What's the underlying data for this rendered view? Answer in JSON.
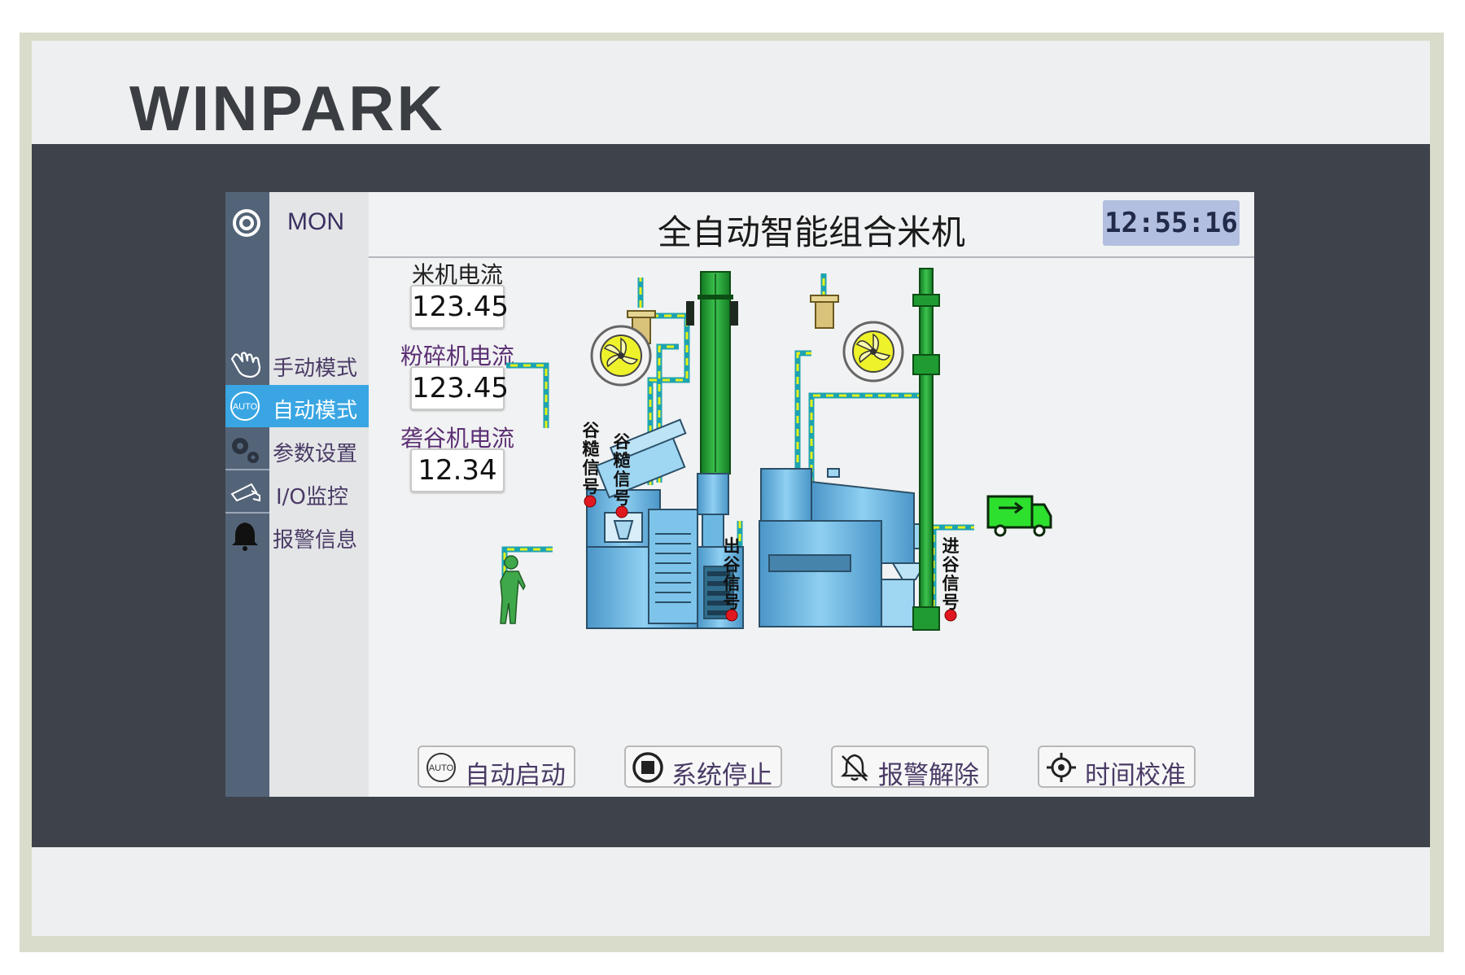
{
  "brand": "WINPARK",
  "screen": {
    "mon_label": "MON",
    "title": "全自动智能组合米机",
    "clock": "12:55:16"
  },
  "menu": {
    "items": [
      {
        "label": "手动模式",
        "icon": "hand-icon"
      },
      {
        "label": "自动模式",
        "icon": "auto-icon",
        "active": true
      },
      {
        "label": "参数设置",
        "icon": "gears-icon"
      },
      {
        "label": "I/O监控",
        "icon": "camera-icon"
      },
      {
        "label": "报警信息",
        "icon": "bell-icon"
      }
    ]
  },
  "metrics": [
    {
      "label": "米机电流",
      "value": "123.45"
    },
    {
      "label": "粉碎机电流",
      "value": "123.45"
    },
    {
      "label": "砻谷机电流",
      "value": "12.34"
    }
  ],
  "signals": {
    "grain_husk_1": "谷糙信号",
    "grain_husk_2": "谷糙信号",
    "grain_out": "出谷信号",
    "grain_in": "进谷信号"
  },
  "buttons": [
    {
      "label": "自动启动",
      "icon": "auto-icon"
    },
    {
      "label": "系统停止",
      "icon": "stop-icon"
    },
    {
      "label": "报警解除",
      "icon": "bell-off-icon"
    },
    {
      "label": "时间校准",
      "icon": "crosshair-icon"
    }
  ],
  "colors": {
    "active_menu": "#39a6e3",
    "bezel": "#3e424a",
    "rail": "#546478",
    "clock_bg": "#b3bfe0",
    "pipe": "#1ea3b0",
    "pipe_dash": "#e8f01a",
    "elevator": "#1f9b32",
    "machine": "#6cb8e2",
    "signal": "#e01820",
    "truck": "#2ee02e"
  }
}
